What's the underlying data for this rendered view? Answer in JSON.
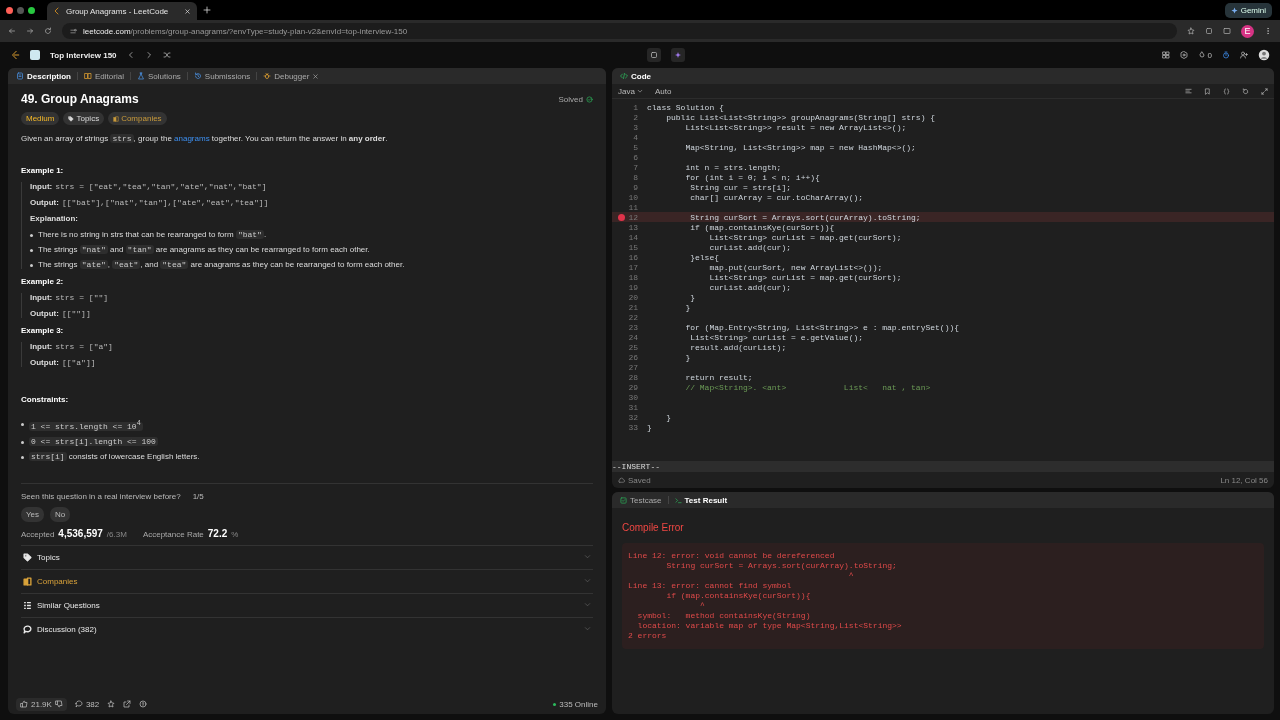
{
  "browser": {
    "tab_title": "Group Anagrams - LeetCode",
    "url_host": "leetcode.com",
    "url_path": "/problems/group-anagrams/?envType=study-plan-v2&envId=top-interview-150",
    "gemini": "Gemini",
    "profile_initial": "E"
  },
  "nav": {
    "list_title": "Top Interview 150",
    "streak": "0"
  },
  "left_tabs": [
    {
      "label": "Description",
      "selected": true,
      "closable": false
    },
    {
      "label": "Editorial",
      "selected": false,
      "closable": false
    },
    {
      "label": "Solutions",
      "selected": false,
      "closable": false
    },
    {
      "label": "Submissions",
      "selected": false,
      "closable": false
    },
    {
      "label": "Debugger",
      "selected": false,
      "closable": true
    }
  ],
  "problem": {
    "title": "49. Group Anagrams",
    "status": "Solved",
    "tags": [
      {
        "label": "Medium",
        "kind": "difficulty"
      },
      {
        "label": "Topics",
        "kind": "topics"
      },
      {
        "label": "Companies",
        "kind": "companies"
      }
    ],
    "description": [
      {
        "kind": "text",
        "text": "Given an array of strings "
      },
      {
        "kind": "code",
        "text": "strs"
      },
      {
        "kind": "text",
        "text": ", group the "
      },
      {
        "kind": "link",
        "text": "anagrams"
      },
      {
        "kind": "text",
        "text": " together. You can return the answer in "
      },
      {
        "kind": "bold",
        "text": "any order"
      },
      {
        "kind": "text",
        "text": "."
      }
    ],
    "examples": [
      {
        "title": "Example 1:",
        "input_label": "Input:",
        "input": "strs = [\"eat\",\"tea\",\"tan\",\"ate\",\"nat\",\"bat\"]",
        "output_label": "Output:",
        "output": "[[\"bat\"],[\"nat\",\"tan\"],[\"ate\",\"eat\",\"tea\"]]",
        "explanation_label": "Explanation:",
        "explanation": [
          [
            {
              "kind": "text",
              "text": "There is no string in strs that can be rearranged to form "
            },
            {
              "kind": "code",
              "text": "\"bat\""
            },
            {
              "kind": "text",
              "text": "."
            }
          ],
          [
            {
              "kind": "text",
              "text": "The strings "
            },
            {
              "kind": "code",
              "text": "\"nat\""
            },
            {
              "kind": "text",
              "text": " and "
            },
            {
              "kind": "code",
              "text": "\"tan\""
            },
            {
              "kind": "text",
              "text": " are anagrams as they can be rearranged to form each other."
            }
          ],
          [
            {
              "kind": "text",
              "text": "The strings "
            },
            {
              "kind": "code",
              "text": "\"ate\""
            },
            {
              "kind": "text",
              "text": ", "
            },
            {
              "kind": "code",
              "text": "\"eat\""
            },
            {
              "kind": "text",
              "text": ", and "
            },
            {
              "kind": "code",
              "text": "\"tea\""
            },
            {
              "kind": "text",
              "text": " are anagrams as they can be rearranged to form each other."
            }
          ]
        ]
      },
      {
        "title": "Example 2:",
        "input_label": "Input:",
        "input": "strs = [\"\"]",
        "output_label": "Output:",
        "output": "[[\"\"]]"
      },
      {
        "title": "Example 3:",
        "input_label": "Input:",
        "input": "strs = [\"a\"]",
        "output_label": "Output:",
        "output": "[[\"a\"]]"
      }
    ],
    "constraints_title": "Constraints:",
    "constraints": [
      [
        {
          "kind": "code",
          "text": "1 <= strs.length <= 10$^{4}$"
        }
      ],
      [
        {
          "kind": "code",
          "text": "0 <= strs[i].length <= 100"
        }
      ],
      [
        {
          "kind": "code",
          "text": "strs[i]"
        },
        {
          "kind": "text",
          "text": " consists of lowercase English letters."
        }
      ]
    ]
  },
  "interview": {
    "question": "Seen this question in a real interview before?",
    "ratio": "1/5",
    "answers": [
      "Yes",
      "No"
    ]
  },
  "stats": {
    "accepted_label": "Accepted",
    "accepted": "4,536,597",
    "submissions": "/6.3M",
    "rate_label": "Acceptance Rate",
    "rate": "72.2",
    "rate_unit": "%"
  },
  "sections": [
    {
      "label": "Topics",
      "color": "#e8e8e8"
    },
    {
      "label": "Companies",
      "color": "#d9a23a"
    },
    {
      "label": "Similar Questions",
      "color": "#e8e8e8"
    },
    {
      "label": "Discussion (382)",
      "color": "#e8e8e8"
    }
  ],
  "footer": {
    "likes": "21.9K",
    "comments": "382",
    "online": "335 Online"
  },
  "editor": {
    "title": "Code",
    "language": "Java",
    "mode": "Auto",
    "lines": [
      {
        "num": "1",
        "text": "class Solution {",
        "kind": "code",
        "error": false
      },
      {
        "num": "2",
        "text": "    public List<List<String>> groupAnagrams(String[] strs) {",
        "kind": "code",
        "error": false
      },
      {
        "num": "3",
        "text": "        List<List<String>> result = new ArrayList<>();",
        "kind": "code",
        "error": false
      },
      {
        "num": "4",
        "error": false
      },
      {
        "num": "5",
        "text": "        Map<String, List<String>> map = new HashMap<>();",
        "kind": "code",
        "error": false
      },
      {
        "num": "6",
        "error": false
      },
      {
        "num": "7",
        "text": "        int n = strs.length;",
        "kind": "code",
        "error": false
      },
      {
        "num": "8",
        "text": "        for (int i = 0; i < n; i++){",
        "kind": "code",
        "error": false
      },
      {
        "num": "9",
        "text": "         String cur = strs[i];",
        "kind": "code",
        "error": false
      },
      {
        "num": "10",
        "text": "         char[] curArray = cur.toCharArray();",
        "kind": "code",
        "error": false
      },
      {
        "num": "11",
        "error": false
      },
      {
        "num": "12",
        "text": "         String curSort = Arrays.sort(curArray).toString;",
        "kind": "code",
        "error": true
      },
      {
        "num": "13",
        "text": "         if (map.containsKye(curSort)){",
        "kind": "code",
        "error": false
      },
      {
        "num": "14",
        "text": "             List<String> curList = map.get(curSort);",
        "kind": "code",
        "error": false
      },
      {
        "num": "15",
        "text": "             curList.add(cur);",
        "kind": "code",
        "error": false
      },
      {
        "num": "16",
        "text": "         }else{",
        "kind": "code",
        "error": false
      },
      {
        "num": "17",
        "text": "             map.put(curSort, new ArrayList<>());",
        "kind": "code",
        "error": false
      },
      {
        "num": "18",
        "text": "             List<String> curList = map.get(curSort);",
        "kind": "code",
        "error": false
      },
      {
        "num": "19",
        "text": "             curList.add(cur);",
        "kind": "code",
        "error": false
      },
      {
        "num": "20",
        "text": "         }",
        "kind": "code",
        "error": false
      },
      {
        "num": "21",
        "text": "        }",
        "kind": "code",
        "error": false
      },
      {
        "num": "22",
        "error": false
      },
      {
        "num": "23",
        "text": "        for (Map.Entry<String, List<String>> e : map.entrySet()){",
        "kind": "code",
        "error": false
      },
      {
        "num": "24",
        "text": "         List<String> curList = e.getValue();",
        "kind": "code",
        "error": false
      },
      {
        "num": "25",
        "text": "         result.add(curList);",
        "kind": "code",
        "error": false
      },
      {
        "num": "26",
        "text": "        }",
        "kind": "code",
        "error": false
      },
      {
        "num": "27",
        "error": false
      },
      {
        "num": "28",
        "text": "        return result;",
        "kind": "code",
        "error": false
      },
      {
        "num": "29",
        "text": "        // Map<String>. <ant>            List<   nat , tan>",
        "kind": "comment",
        "error": false
      },
      {
        "num": "30",
        "error": false
      },
      {
        "num": "31",
        "error": false
      },
      {
        "num": "32",
        "text": "    }",
        "kind": "code",
        "error": false
      },
      {
        "num": "33",
        "text": "}",
        "kind": "code",
        "error": false
      }
    ],
    "vim_mode": "--INSERT--",
    "save_state": "Saved",
    "cursor": "Ln 12, Col 56"
  },
  "result_panel": {
    "tabs": [
      {
        "label": "Testcase",
        "selected": false
      },
      {
        "label": "Test Result",
        "selected": true
      }
    ],
    "verdict": "Compile Error",
    "log": "Line 12: error: void cannot be dereferenced\n        String curSort = Arrays.sort(curArray).toString;\n                                              ^\nLine 13: error: cannot find symbol\n        if (map.containsKye(curSort)){\n               ^\n  symbol:   method containsKye(String)\n  location: variable map of type Map<String,List<String>>\n2 errors"
  }
}
